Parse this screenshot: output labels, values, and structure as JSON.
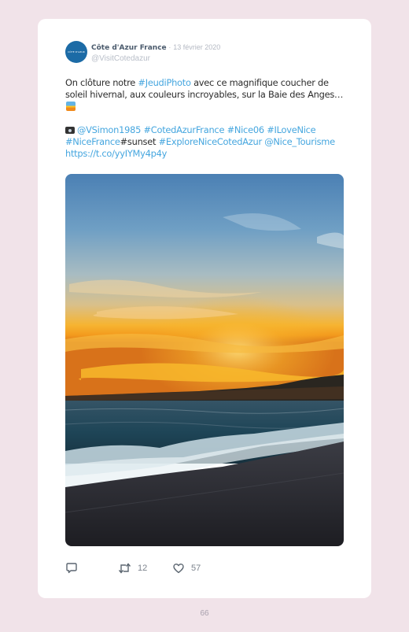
{
  "account": {
    "avatar_text": "CÔTE D'AZUR",
    "name": "Côte d'Azur France",
    "separator": "·",
    "date": "13 février 2020",
    "handle": "@VisitCotedazur"
  },
  "tweet": {
    "intro": "On clôture notre ",
    "hashtag_jeudi": "#JeudiPhoto",
    "body": " avec ce magnifique coucher de soleil hivernal, aux couleurs incroyables, sur la Baie des Anges…",
    "credit": "@VSimon1985",
    "hashtags_1": "#CotedAzurFrance #Nice06 #ILoveNice",
    "hashtag_nicefrance": "#NiceFrance",
    "plain_sunset": "#sunset",
    "hashtag_explore": "#ExploreNiceCotedAzur",
    "mention": "@Nice_Tourisme",
    "url": "https://t.co/yyIYMy4p4y",
    "emojis": [
      "sunrise-emoji",
      "camera-emoji"
    ]
  },
  "photo": {
    "description_icon": "sunset-over-bay-photo",
    "palette": {
      "sky_top": "#4f86b8",
      "sky_mid": "#9db9c8",
      "glow": "#f7b52b",
      "horizon": "#f08a1b",
      "sea": "#1c3a4a",
      "beach": "#2b2b30"
    }
  },
  "actions": {
    "retweets": "12",
    "likes": "57",
    "icons": [
      "reply-icon",
      "retweet-icon",
      "like-icon"
    ],
    "icon_color": "#5b6570"
  },
  "page": {
    "number": "66"
  },
  "colors": {
    "background": "#f1e3e9",
    "card": "#ffffff",
    "link": "#45a6df",
    "avatar": "#1c6ba6"
  }
}
